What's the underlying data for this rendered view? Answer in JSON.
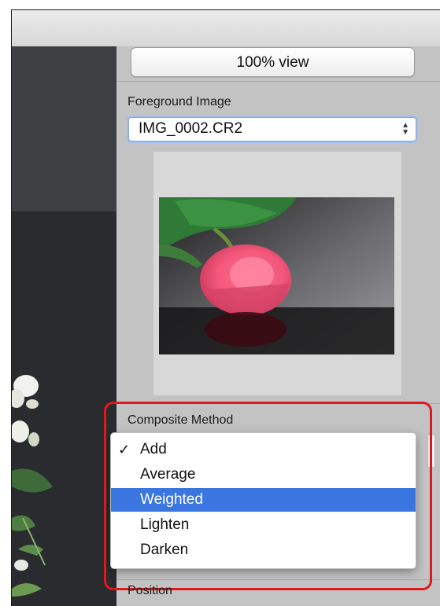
{
  "toolbar": {
    "view_button_label": "100% view"
  },
  "foreground": {
    "section_label": "Foreground Image",
    "selected_file": "IMG_0002.CR2"
  },
  "composite": {
    "section_label": "Composite Method",
    "options": [
      {
        "label": "Add",
        "checked": true,
        "highlighted": false
      },
      {
        "label": "Average",
        "checked": false,
        "highlighted": false
      },
      {
        "label": "Weighted",
        "checked": false,
        "highlighted": true
      },
      {
        "label": "Lighten",
        "checked": false,
        "highlighted": false
      },
      {
        "label": "Darken",
        "checked": false,
        "highlighted": false
      }
    ],
    "check_glyph": "✓"
  },
  "position": {
    "section_label": "Position"
  },
  "colors": {
    "accent_highlight": "#3b75e0",
    "annotation_red": "#e0181d"
  }
}
